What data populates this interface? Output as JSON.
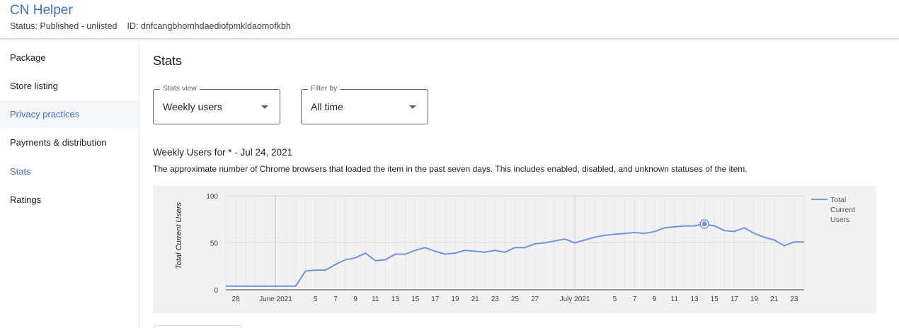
{
  "header": {
    "title": "CN Helper",
    "status": "Status: Published - unlisted",
    "id": "ID: dnfcangbhomhdaediofpmkldaomofkbh"
  },
  "sidebar": {
    "items": [
      {
        "label": "Package"
      },
      {
        "label": "Store listing"
      },
      {
        "label": "Privacy practices"
      },
      {
        "label": "Payments & distribution"
      },
      {
        "label": "Stats"
      },
      {
        "label": "Ratings"
      }
    ]
  },
  "main": {
    "title": "Stats",
    "stats_view": {
      "legend": "Stats view",
      "value": "Weekly users"
    },
    "filter_by": {
      "legend": "Filter by",
      "value": "All time"
    },
    "chart_heading": "Weekly Users for * - Jul 24, 2021",
    "chart_description": "The approximate number of Chrome browsers that loaded the item in the past seven days. This includes enabled, disabled, and unknown statuses of the item."
  },
  "colors": {
    "accent": "#3c6ee0",
    "line": "#6d95e6",
    "chart_bg": "#f1f1f1"
  },
  "chart_data": {
    "type": "line",
    "ylabel": "Total Current Users",
    "ylim": [
      0,
      100
    ],
    "yticks": [
      "0",
      "50",
      "100"
    ],
    "xticks": [
      "28",
      "June 2021",
      "5",
      "7",
      "9",
      "11",
      "13",
      "15",
      "17",
      "19",
      "21",
      "23",
      "25",
      "27",
      "July 2021",
      "5",
      "7",
      "9",
      "11",
      "13",
      "15",
      "17",
      "19",
      "21",
      "23"
    ],
    "legend": "top-right",
    "series": [
      {
        "name": "Total Current Users",
        "x": [
          "May 27",
          "May 28",
          "May 29",
          "May 30",
          "May 31",
          "Jun 1",
          "Jun 2",
          "Jun 3",
          "Jun 4",
          "Jun 5",
          "Jun 6",
          "Jun 7",
          "Jun 8",
          "Jun 9",
          "Jun 10",
          "Jun 11",
          "Jun 12",
          "Jun 13",
          "Jun 14",
          "Jun 15",
          "Jun 16",
          "Jun 17",
          "Jun 18",
          "Jun 19",
          "Jun 20",
          "Jun 21",
          "Jun 22",
          "Jun 23",
          "Jun 24",
          "Jun 25",
          "Jun 26",
          "Jun 27",
          "Jun 28",
          "Jun 29",
          "Jun 30",
          "Jul 1",
          "Jul 2",
          "Jul 3",
          "Jul 4",
          "Jul 5",
          "Jul 6",
          "Jul 7",
          "Jul 8",
          "Jul 9",
          "Jul 10",
          "Jul 11",
          "Jul 12",
          "Jul 13",
          "Jul 14",
          "Jul 15",
          "Jul 16",
          "Jul 17",
          "Jul 18",
          "Jul 19",
          "Jul 20",
          "Jul 21",
          "Jul 22",
          "Jul 23",
          "Jul 24"
        ],
        "values": [
          4,
          4,
          4,
          4,
          4,
          4,
          4,
          4,
          20,
          21,
          21,
          27,
          32,
          34,
          39,
          31,
          32,
          38,
          38,
          42,
          45,
          41,
          38,
          39,
          42,
          41,
          40,
          42,
          40,
          45,
          45,
          49,
          50,
          52,
          54,
          50,
          53,
          56,
          58,
          59,
          60,
          61,
          60,
          62,
          66,
          67,
          68,
          68,
          70,
          68,
          63,
          62,
          66,
          60,
          56,
          53,
          47,
          51,
          51
        ]
      }
    ],
    "highlight": {
      "x": "Jul 14",
      "value": 70
    }
  }
}
